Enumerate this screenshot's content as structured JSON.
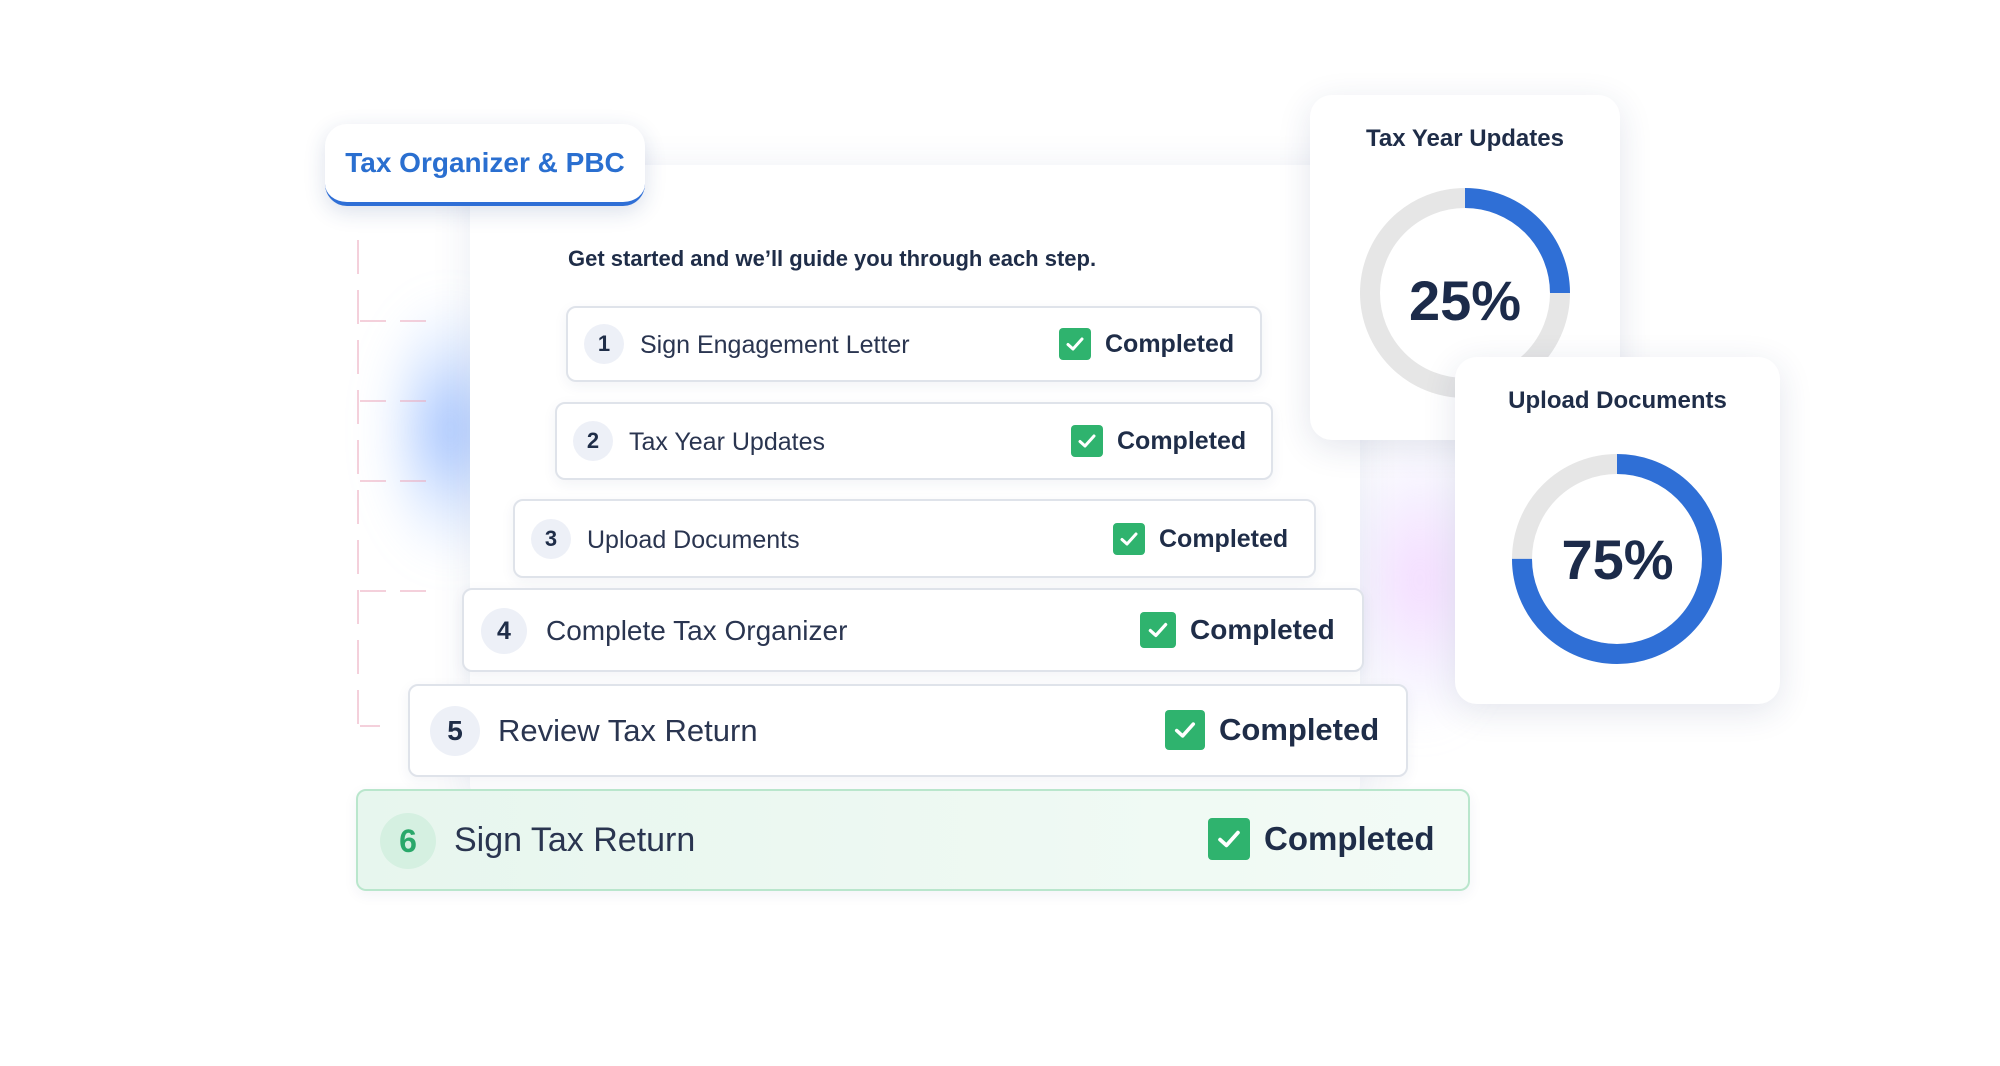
{
  "tab": {
    "label": "Tax Organizer & PBC"
  },
  "intro": "Get started and we’ll guide you through each step.",
  "steps": [
    {
      "number": "1",
      "label": "Sign Engagement Letter",
      "status": "Completed"
    },
    {
      "number": "2",
      "label": "Tax Year Updates",
      "status": "Completed"
    },
    {
      "number": "3",
      "label": "Upload Documents",
      "status": "Completed"
    },
    {
      "number": "4",
      "label": "Complete Tax Organizer",
      "status": "Completed"
    },
    {
      "number": "5",
      "label": "Review Tax Return",
      "status": "Completed"
    },
    {
      "number": "6",
      "label": "Sign Tax Return",
      "status": "Completed"
    }
  ],
  "cards": [
    {
      "title": "Tax Year Updates",
      "percent_label": "25%",
      "progress": 0.25
    },
    {
      "title": "Upload Documents",
      "percent_label": "75%",
      "progress": 0.75
    }
  ],
  "colors": {
    "accent_blue": "#2f6fd6",
    "success_green": "#2fb36e",
    "track_gray": "#e6e6e6"
  },
  "icons": {
    "check": "check-icon"
  }
}
